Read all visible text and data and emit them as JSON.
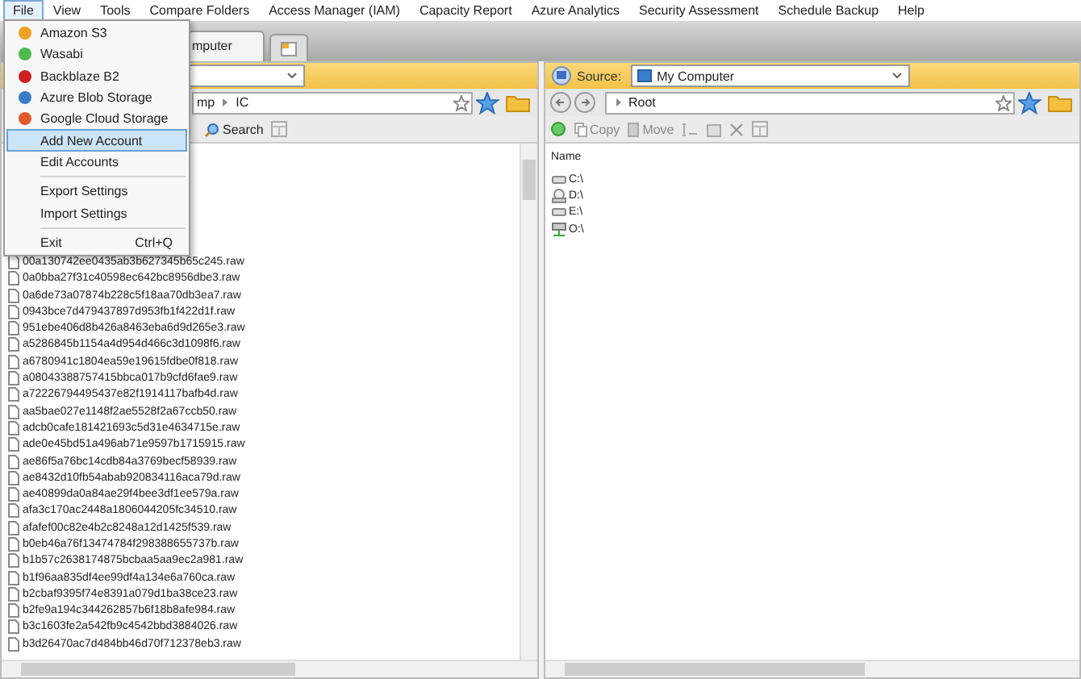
{
  "menu_bar": [
    {
      "label": "File",
      "selected": true
    },
    {
      "label": "View",
      "selected": false
    },
    {
      "label": "Tools",
      "selected": false
    },
    {
      "label": "Compare Folders",
      "selected": false
    },
    {
      "label": "Access Manager (IAM)",
      "selected": false
    },
    {
      "label": "Capacity Report",
      "selected": false
    },
    {
      "label": "Azure Analytics",
      "selected": false
    },
    {
      "label": "Security Assessment",
      "selected": false
    },
    {
      "label": "Schedule Backup",
      "selected": false
    },
    {
      "label": "Help",
      "selected": false
    }
  ],
  "file_menu": [
    {
      "kind": "account",
      "label": "Amazon S3",
      "selected": false
    },
    {
      "kind": "account",
      "label": "Wasabi",
      "selected": false
    },
    {
      "kind": "account",
      "label": "Backblaze B2",
      "selected": false
    },
    {
      "kind": "account",
      "label": "Azure Blob Storage",
      "selected": false
    },
    {
      "kind": "account",
      "label": "Google Cloud Storage",
      "selected": false
    },
    {
      "kind": "action",
      "label": "Add New Account",
      "selected": true
    },
    {
      "kind": "action",
      "label": "Edit Accounts",
      "selected": false
    },
    {
      "kind": "separator"
    },
    {
      "kind": "action",
      "label": "Export Settings",
      "selected": false
    },
    {
      "kind": "action",
      "label": "Import Settings",
      "selected": false
    },
    {
      "kind": "separator"
    },
    {
      "kind": "action",
      "label": "Exit",
      "shortcut": "Ctrl+Q",
      "selected": false
    }
  ],
  "left_pane": {
    "tab_label": "mputer",
    "path": [
      "mp",
      "IC"
    ],
    "toolbar": [
      "Search"
    ],
    "files": [
      "00a130742ee0435ab3b627345b65c245.raw",
      "0a0bba27f31c40598ec642bc8956dbe3.raw",
      "0a6de73a07874b228c5f18aa70db3ea7.raw",
      "0943bce7d479437897d953fb1f422d1f.raw",
      "951ebe406d8b426a8463eba6d9d265e3.raw",
      "a5286845b1154a4d954d466c3d1098f6.raw",
      "a6780941c1804ea59e19615fdbe0f818.raw",
      "a08043388757415bbca017b9cfd6fae9.raw",
      "a72226794495437e82f1914117bafb4d.raw",
      "aa5bae027e1148f2ae5528f2a67ccb50.raw",
      "adcb0cafe181421693c5d31e4634715e.raw",
      "ade0e45bd51a496ab71e9597b1715915.raw",
      "ae86f5a76bc14cdb84a3769becf58939.raw",
      "ae8432d10fb54abab920834116aca79d.raw",
      "ae40899da0a84ae29f4bee3df1ee579a.raw",
      "afa3c170ac2448a1806044205fc34510.raw",
      "afafef00c82e4b2c8248a12d1425f539.raw",
      "b0eb46a76f13474784f298388655737b.raw",
      "b1b57c2638174875bcbaa5aa9ec2a981.raw",
      "b1f96aa835df4ee99df4a134e6a760ca.raw",
      "b2cbaf9395f74e8391a079d1ba38ce23.raw",
      "b2fe9a194c344262857b6f18b8afe984.raw",
      "b3c1603fe2a542fb9c4542bbd3884026.raw",
      "b3d26470ac7d484bb46d70f712378eb3.raw"
    ]
  },
  "right_pane": {
    "source_label": "Source:",
    "source_value": "My Computer",
    "path": "Root",
    "toolbar": [
      "Copy",
      "Move"
    ],
    "column": "Name",
    "drives": [
      {
        "kind": "disk",
        "label": "C:\\"
      },
      {
        "kind": "optical",
        "label": "D:\\"
      },
      {
        "kind": "disk",
        "label": "E:\\"
      },
      {
        "kind": "network",
        "label": "O:\\"
      }
    ]
  }
}
